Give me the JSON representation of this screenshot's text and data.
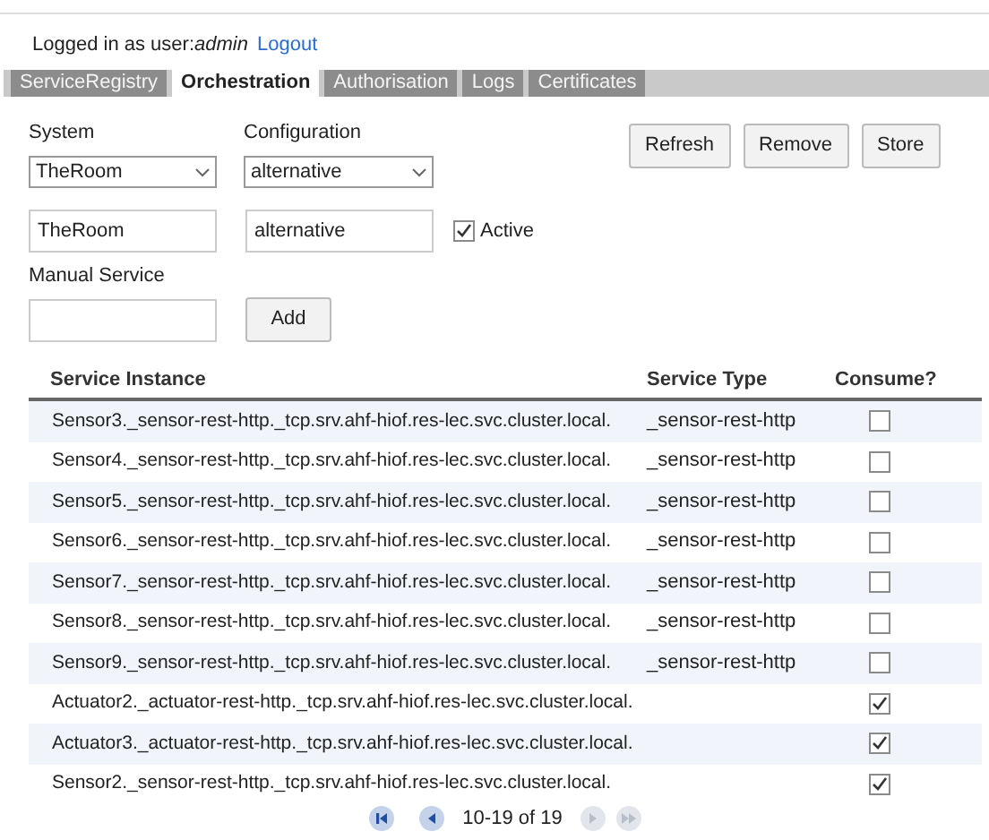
{
  "login": {
    "prefix": "Logged in as user:",
    "user": "admin",
    "logout": "Logout"
  },
  "tabs": [
    {
      "label": "ServiceRegistry",
      "selected": false
    },
    {
      "label": "Orchestration",
      "selected": true
    },
    {
      "label": "Authorisation",
      "selected": false
    },
    {
      "label": "Logs",
      "selected": false
    },
    {
      "label": "Certificates",
      "selected": false
    }
  ],
  "system": {
    "label": "System",
    "value": "TheRoom"
  },
  "configuration": {
    "label": "Configuration",
    "value": "alternative"
  },
  "buttons": [
    "Refresh",
    "Remove",
    "Store"
  ],
  "system_name": "TheRoom",
  "configuration_name": "alternative",
  "active": {
    "label": "Active",
    "checked": true
  },
  "manual_service": {
    "label": "Manual Service",
    "button": "Add"
  },
  "table": {
    "columns": [
      "Service Instance",
      "Service Type",
      "Consume?"
    ],
    "rows": [
      {
        "instance": "Sensor3._sensor-rest-http._tcp.srv.ahf-hiof.res-lec.svc.cluster.local.",
        "type": "_sensor-rest-http",
        "checked": false
      },
      {
        "instance": "Sensor4._sensor-rest-http._tcp.srv.ahf-hiof.res-lec.svc.cluster.local.",
        "type": "_sensor-rest-http",
        "checked": false
      },
      {
        "instance": "Sensor5._sensor-rest-http._tcp.srv.ahf-hiof.res-lec.svc.cluster.local.",
        "type": "_sensor-rest-http",
        "checked": false
      },
      {
        "instance": "Sensor6._sensor-rest-http._tcp.srv.ahf-hiof.res-lec.svc.cluster.local.",
        "type": "_sensor-rest-http",
        "checked": false
      },
      {
        "instance": "Sensor7._sensor-rest-http._tcp.srv.ahf-hiof.res-lec.svc.cluster.local.",
        "type": "_sensor-rest-http",
        "checked": false
      },
      {
        "instance": "Sensor8._sensor-rest-http._tcp.srv.ahf-hiof.res-lec.svc.cluster.local.",
        "type": "_sensor-rest-http",
        "checked": false
      },
      {
        "instance": "Sensor9._sensor-rest-http._tcp.srv.ahf-hiof.res-lec.svc.cluster.local.",
        "type": "_sensor-rest-http",
        "checked": false
      },
      {
        "instance": "Actuator2._actuator-rest-http._tcp.srv.ahf-hiof.res-lec.svc.cluster.local.",
        "checked": true
      },
      {
        "instance": "Actuator3._actuator-rest-http._tcp.srv.ahf-hiof.res-lec.svc.cluster.local.",
        "checked": true
      },
      {
        "instance": "Sensor2._sensor-rest-http._tcp.srv.ahf-hiof.res-lec.svc.cluster.local.",
        "checked": true
      }
    ]
  },
  "pagination": {
    "range": "10-19 of 19",
    "controls": [
      {
        "kind": "first",
        "disabled": false
      },
      {
        "kind": "prev",
        "disabled": false
      },
      {
        "kind": "next",
        "disabled": true
      },
      {
        "kind": "last",
        "disabled": true
      }
    ]
  }
}
